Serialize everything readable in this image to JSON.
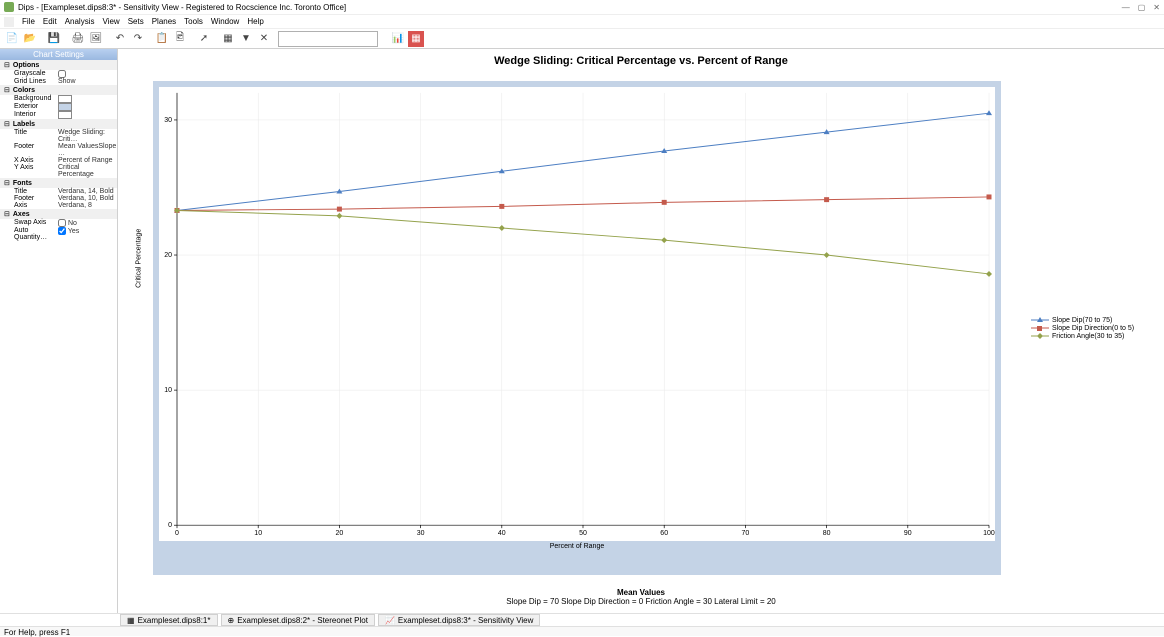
{
  "window": {
    "title": "Dips - [Exampleset.dips8:3* - Sensitivity View - Registered to Rocscience Inc. Toronto Office]"
  },
  "menu": [
    "File",
    "Edit",
    "Analysis",
    "View",
    "Sets",
    "Planes",
    "Tools",
    "Window",
    "Help"
  ],
  "sidebar": {
    "title": "Chart Settings",
    "options": {
      "label": "Options",
      "grayscale": "Grayscale",
      "grayscale_val": "",
      "gridlines": "Grid Lines",
      "gridlines_val": "Show"
    },
    "colors": {
      "label": "Colors",
      "bg": "Background",
      "ext": "Exterior",
      "int": "Interior"
    },
    "labels": {
      "label": "Labels",
      "title_k": "Title",
      "title_v": "Wedge Sliding: Criti…",
      "footer_k": "Footer",
      "footer_v": "Mean ValuesSlope …",
      "x_k": "X Axis",
      "x_v": "Percent of Range",
      "y_k": "Y Axis",
      "y_v": "Critical Percentage"
    },
    "fonts": {
      "label": "Fonts",
      "title_k": "Title",
      "title_v": "Verdana, 14, Bold",
      "footer_k": "Footer",
      "footer_v": "Verdana, 10, Bold",
      "axis_k": "Axis",
      "axis_v": "Verdana, 8"
    },
    "axes": {
      "label": "Axes",
      "swap_k": "Swap Axis",
      "swap_v": "No",
      "auto_k": "Auto Quantity…",
      "auto_v": "Yes"
    }
  },
  "chart_data": {
    "type": "line",
    "title": "Wedge Sliding: Critical Percentage vs. Percent of Range",
    "xlabel": "Percent of Range",
    "ylabel": "Critical Percentage",
    "x": [
      0,
      20,
      40,
      60,
      80,
      100
    ],
    "x_ticks": [
      0,
      10,
      20,
      30,
      40,
      50,
      60,
      70,
      80,
      90,
      100
    ],
    "y_ticks": [
      0,
      10,
      20,
      30
    ],
    "xlim": [
      0,
      100
    ],
    "ylim": [
      0,
      32
    ],
    "series": [
      {
        "name": "Slope Dip(70 to 75)",
        "color": "#4c7ec2",
        "marker": "tri",
        "values": [
          23.3,
          24.7,
          26.2,
          27.7,
          29.1,
          30.5
        ]
      },
      {
        "name": "Slope Dip Direction(0 to 5)",
        "color": "#c45a4c",
        "marker": "square",
        "values": [
          23.3,
          23.4,
          23.6,
          23.9,
          24.1,
          24.3
        ]
      },
      {
        "name": "Friction Angle(30 to 35)",
        "color": "#94a24c",
        "marker": "diamond",
        "values": [
          23.3,
          22.9,
          22.0,
          21.1,
          20.0,
          18.6
        ]
      }
    ],
    "legend_pos": "right"
  },
  "footer": {
    "title": "Mean Values",
    "text": "Slope Dip = 70       Slope Dip Direction = 0       Friction Angle = 30       Lateral Limit = 20"
  },
  "doc_tabs": [
    {
      "label": "Exampleset.dips8:1*"
    },
    {
      "label": "Exampleset.dips8:2* - Stereonet Plot"
    },
    {
      "label": "Exampleset.dips8:3* - Sensitivity View"
    }
  ],
  "status": "For Help, press F1"
}
